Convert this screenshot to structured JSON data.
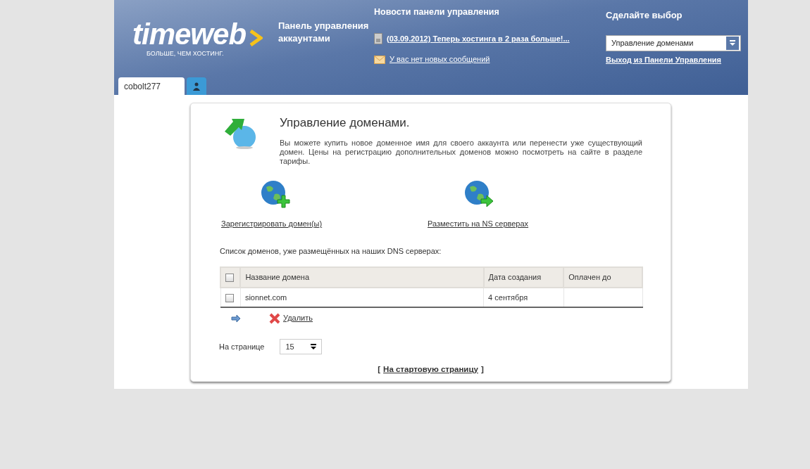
{
  "header": {
    "logo": {
      "text": "timeweb",
      "tagline": "БОЛЬШЕ, ЧЕМ ХОСТИНГ."
    },
    "panel_title": "Панель управления аккаунтами",
    "news": {
      "title": "Новости панели управления",
      "items": [
        {
          "kind": "news",
          "text": "(03.09.2012) Теперь хостинга в 2 раза больше!..."
        },
        {
          "kind": "mail",
          "text": "У вас нет новых сообщений"
        }
      ]
    },
    "choice": {
      "title": "Сделайте выбор",
      "select": "Управление доменами",
      "logout": "Выход из Панели Управления"
    }
  },
  "tabs": [
    {
      "kind": "text",
      "label": "cobolt277",
      "selected": true
    },
    {
      "kind": "user",
      "selected": false
    }
  ],
  "main": {
    "title": "Управление доменами.",
    "description": "Вы можете купить новое доменное имя для своего аккаунта или перенести уже существующий домен. Цены на регистрацию дополнительных доменов можно посмотреть на сайте в разделе тарифы.",
    "actions": [
      {
        "kind": "add",
        "label": "Зарегистрировать домен(ы)"
      },
      {
        "kind": "move",
        "label": "Разместить на NS серверах"
      }
    ],
    "list_caption": "Список доменов, уже размещённых на наших DNS серверах:",
    "table": {
      "select_all_checked": false,
      "columns": [
        "Название домена",
        "Дата создания",
        "Оплачен до"
      ],
      "rows": [
        {
          "checked": false,
          "cells": [
            "sionnet.com",
            "4 сентября",
            ""
          ]
        }
      ]
    },
    "delete": "Удалить",
    "per_page": {
      "label": "На странице",
      "value": "15"
    },
    "home": {
      "open": "[",
      "link": "На стартовую страницу",
      "close": "]"
    }
  }
}
